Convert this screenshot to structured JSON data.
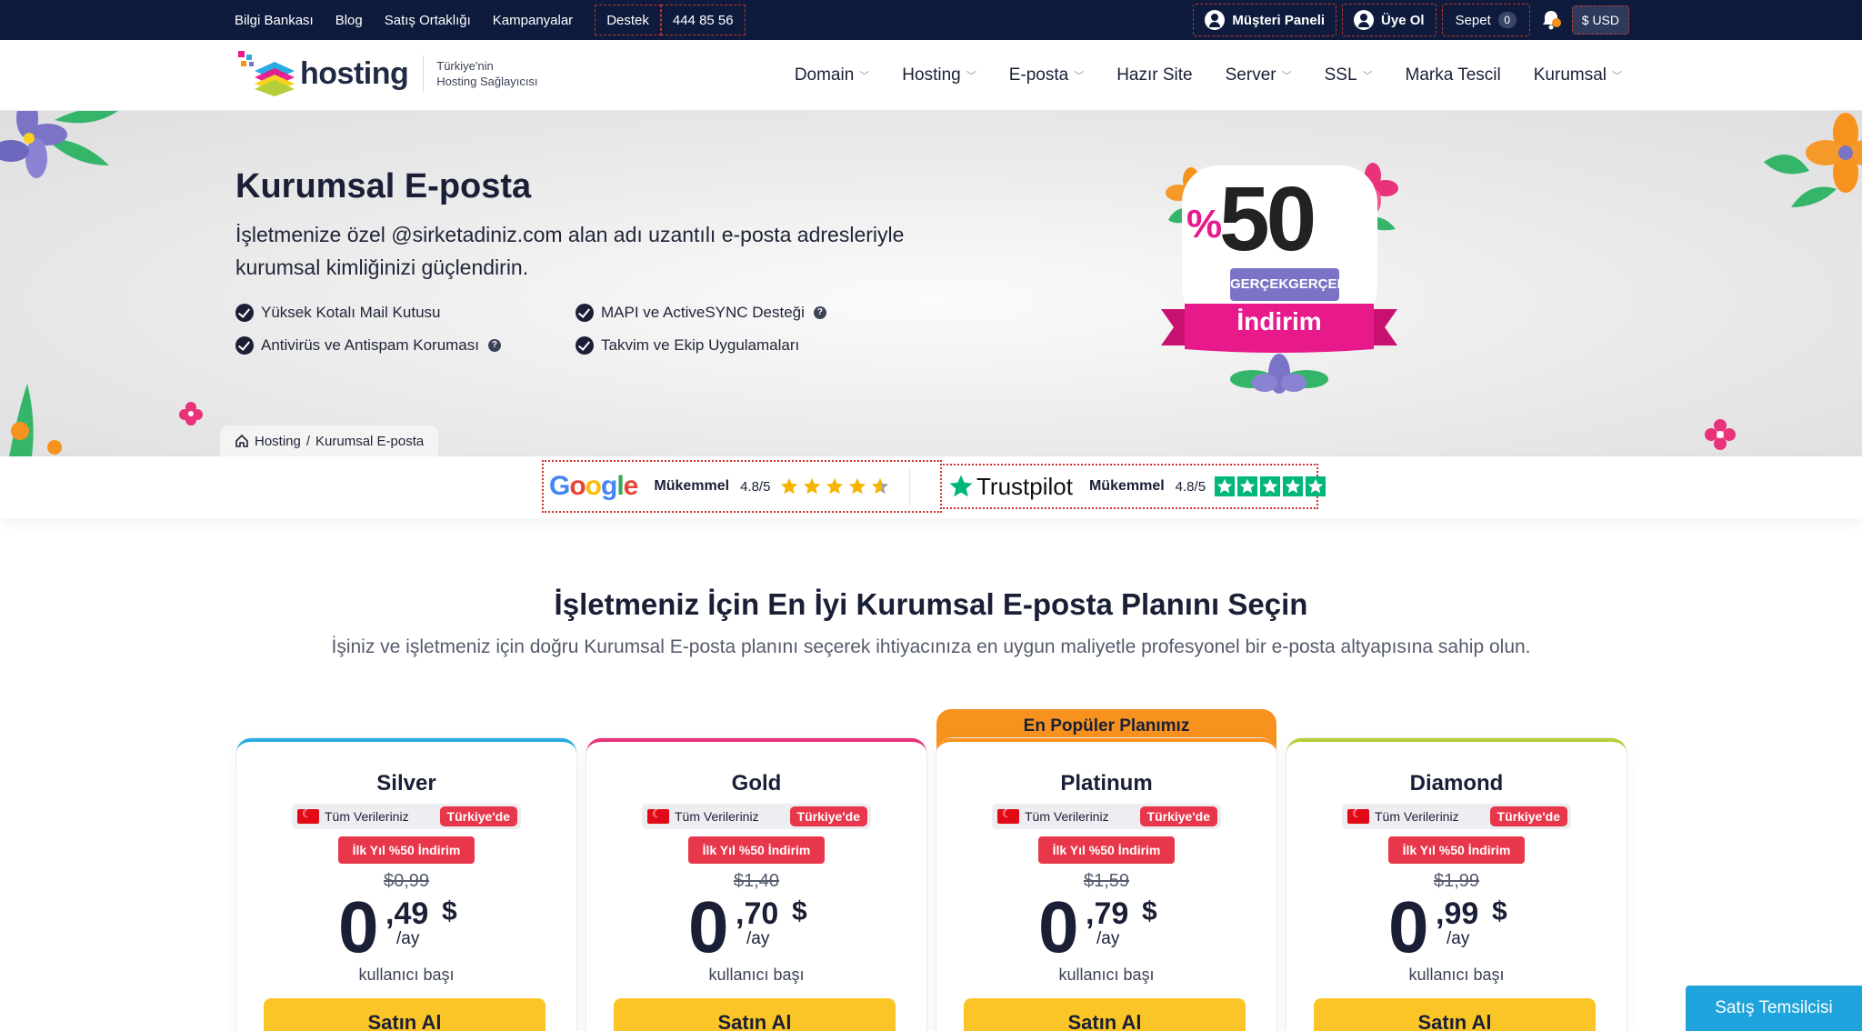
{
  "topbar": {
    "links": [
      "Bilgi Bankası",
      "Blog",
      "Satış Ortaklığı",
      "Kampanyalar"
    ],
    "support": "Destek",
    "phone": "444 85 56",
    "customer_panel": "Müşteri Paneli",
    "signup": "Üye Ol",
    "cart": "Sepet",
    "cart_count": "0",
    "currency": "$ USD"
  },
  "header": {
    "logo_text": "hosting",
    "tagline_1": "Türkiye'nin",
    "tagline_2": "Hosting Sağlayıcısı",
    "nav": [
      {
        "label": "Domain",
        "dropdown": true
      },
      {
        "label": "Hosting",
        "dropdown": true
      },
      {
        "label": "E-posta",
        "dropdown": true
      },
      {
        "label": "Hazır Site",
        "dropdown": false
      },
      {
        "label": "Server",
        "dropdown": true
      },
      {
        "label": "SSL",
        "dropdown": true
      },
      {
        "label": "Marka Tescil",
        "dropdown": false
      },
      {
        "label": "Kurumsal",
        "dropdown": true
      }
    ]
  },
  "hero": {
    "title": "Kurumsal E-posta",
    "lead": "İşletmenize özel @sirketadiniz.com alan adı uzantılı e-posta adresleriyle kurumsal kimliğinizi güçlendirin.",
    "features": [
      {
        "label": "Yüksek Kotalı Mail Kutusu",
        "help": false
      },
      {
        "label": "MAPI ve ActiveSYNC Desteği",
        "help": true
      },
      {
        "label": "Antivirüs ve Antispam Koruması",
        "help": true
      },
      {
        "label": "Takvim ve Ekip Uygulamaları",
        "help": false
      }
    ],
    "breadcrumb": [
      "Hosting",
      "Kurumsal E-posta"
    ],
    "badge": {
      "percent": "%",
      "number": "50",
      "sub": "GERÇEKGERÇEK",
      "ribbon": "İndirim"
    }
  },
  "reviews": {
    "google": {
      "brand": "Google",
      "word": "Mükemmel",
      "score": "4.8/5"
    },
    "trustpilot": {
      "brand": "Trustpilot",
      "word": "Mükemmel",
      "score": "4.8/5"
    }
  },
  "plans_section": {
    "title": "İşletmeniz İçin En İyi Kurumsal E-posta Planını Seçin",
    "subtitle": "İşiniz ve işletmeniz için doğru Kurumsal E-posta planını seçerek ihtiyacınıza en uygun maliyetle profesyonel bir e-posta altyapısına sahip olun.",
    "popular_label": "En Popüler Planımız",
    "plans": [
      {
        "name": "Silver",
        "color": "#29abe2",
        "loc_text": "Tüm Verileriniz",
        "loc_badge": "Türkiye'de",
        "discount": "İlk Yıl %50 İndirim",
        "old_price": "$0,99",
        "int": "0",
        "dec": ",49",
        "cur": "$",
        "per": "/ay",
        "per_user": "kullanıcı başı",
        "buy": "Satın Al"
      },
      {
        "name": "Gold",
        "color": "#e8327a",
        "loc_text": "Tüm Verileriniz",
        "loc_badge": "Türkiye'de",
        "discount": "İlk Yıl %50 İndirim",
        "old_price": "$1,40",
        "int": "0",
        "dec": ",70",
        "cur": "$",
        "per": "/ay",
        "per_user": "kullanıcı başı",
        "buy": "Satın Al"
      },
      {
        "name": "Platinum",
        "color": "#f7921e",
        "loc_text": "Tüm Verileriniz",
        "loc_badge": "Türkiye'de",
        "discount": "İlk Yıl %50 İndirim",
        "old_price": "$1,59",
        "int": "0",
        "dec": ",79",
        "cur": "$",
        "per": "/ay",
        "per_user": "kullanıcı başı",
        "buy": "Satın Al"
      },
      {
        "name": "Diamond",
        "color": "#b5cf3a",
        "loc_text": "Tüm Verileriniz",
        "loc_badge": "Türkiye'de",
        "discount": "İlk Yıl %50 İndirim",
        "old_price": "$1,99",
        "int": "0",
        "dec": ",99",
        "cur": "$",
        "per": "/ay",
        "per_user": "kullanıcı başı",
        "buy": "Satın Al"
      }
    ]
  },
  "sales_button": "Satış Temsilcisi",
  "colors": {
    "topbar": "#0e1b3d",
    "buy": "#fcc527",
    "discount": "#e8374b",
    "popular": "#f7921e",
    "sales": "#1ea3dc",
    "badge_pink": "#e8198b"
  }
}
